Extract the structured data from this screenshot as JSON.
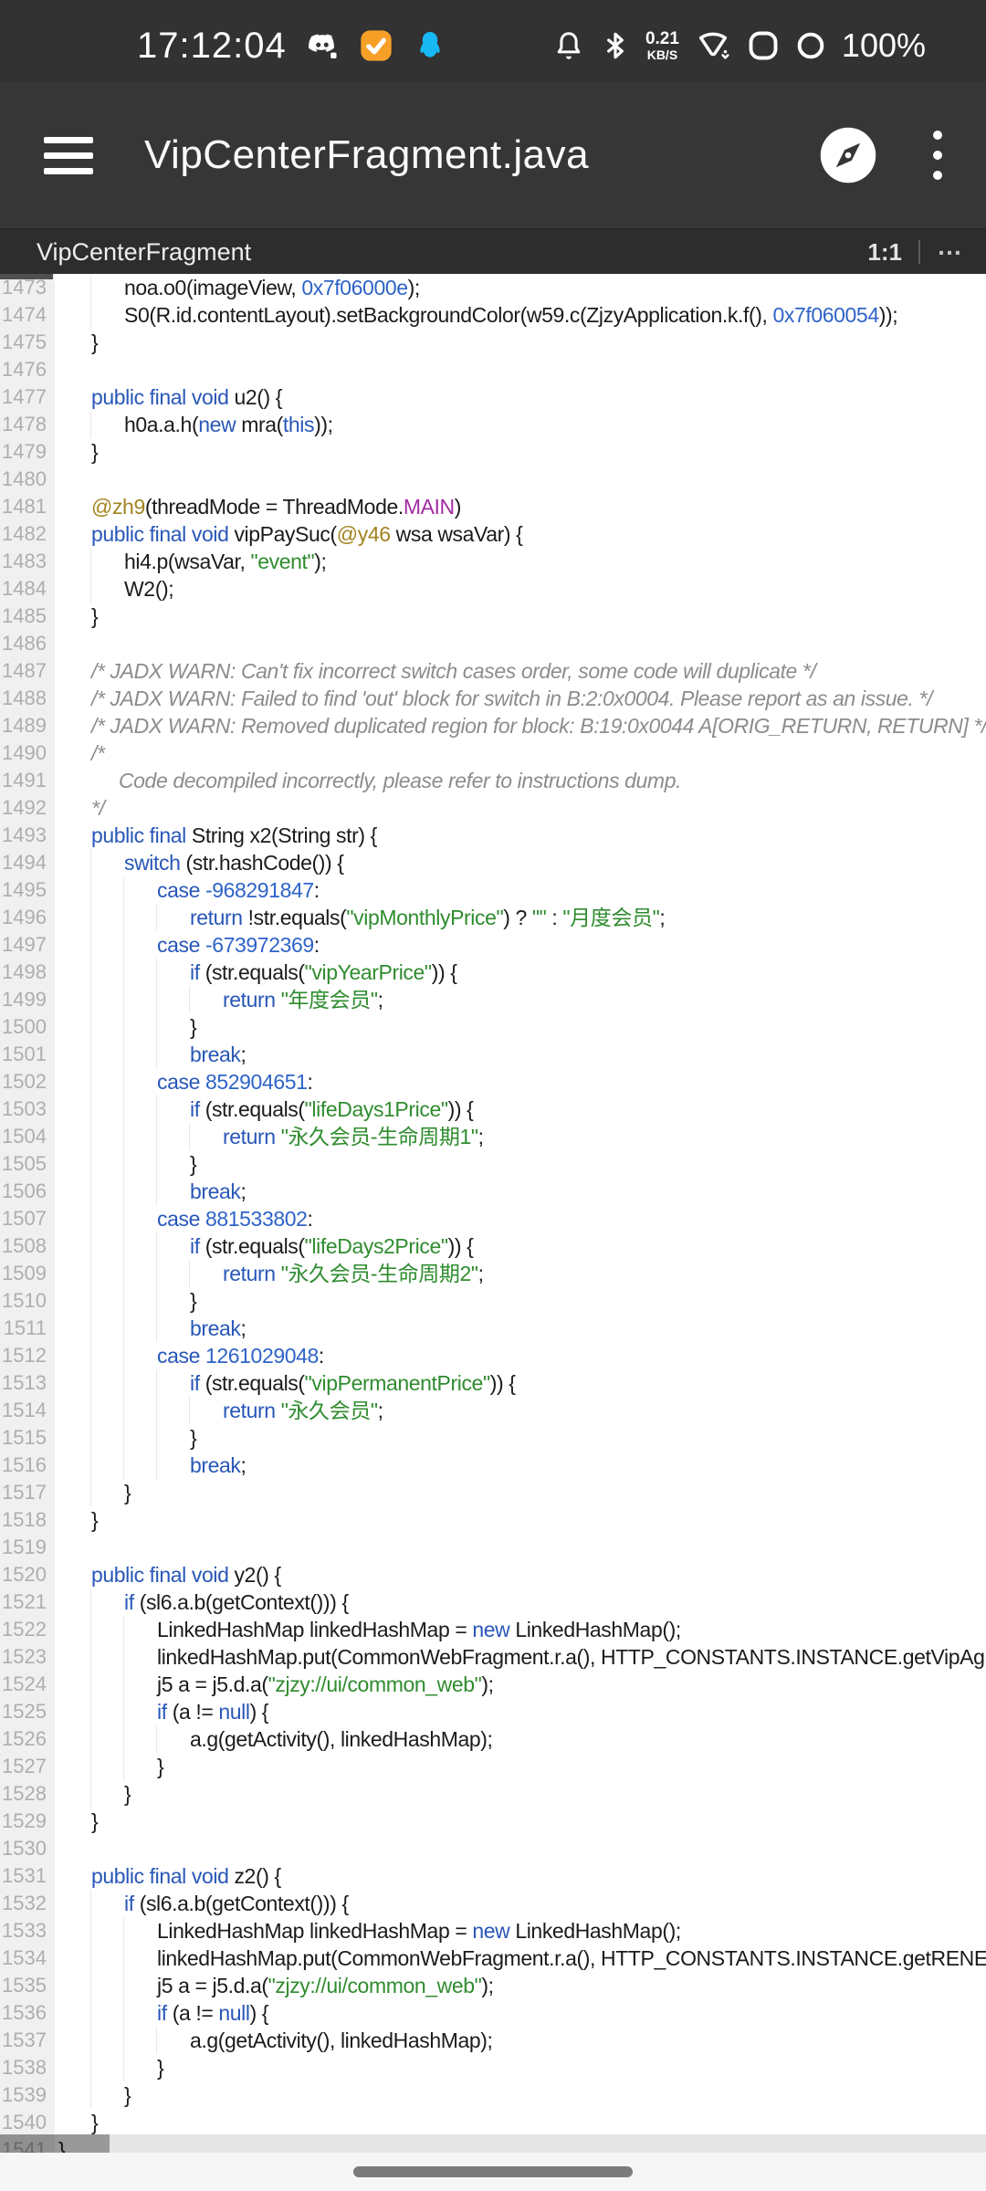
{
  "status_bar": {
    "time": "17:12:04",
    "notification_icons": [
      "discord",
      "checked-task",
      "qq"
    ],
    "system_icons": [
      "notification-bell",
      "bluetooth",
      "wifi",
      "rounded-square-battery",
      "circle-indicator"
    ],
    "network_speed": {
      "value": "0.21",
      "unit": "KB/S"
    },
    "battery_percent": "100%"
  },
  "app_bar": {
    "title": "VipCenterFragment.java"
  },
  "tab_bar": {
    "active_tab": "VipCenterFragment",
    "cursor_position": "1:1",
    "more_label": "…"
  },
  "colors": {
    "header_bg": "#363636",
    "tabbar_bg": "#2d2d2d",
    "code_bg": "#ffffff",
    "gutter_bg": "#f0f0f0",
    "keyword": "#2857b8",
    "number": "#2e63c8",
    "string": "#2f8c2f",
    "annotation": "#a2831d",
    "constant": "#a12ba1",
    "comment": "#8c8c8c",
    "qq_blue": "#18b9f2",
    "badge_orange": "#f7a028"
  },
  "editor": {
    "lines": [
      {
        "n": 1473,
        "i": 2,
        "s": [
          [
            "p",
            "noa.o0(imageView, "
          ],
          [
            "n",
            "0x7f06000e"
          ],
          [
            "p",
            ");"
          ]
        ]
      },
      {
        "n": 1474,
        "i": 2,
        "s": [
          [
            "p",
            "S0(R.id.contentLayout).setBackgroundColor(w59.c(ZjzyApplication.k.f(), "
          ],
          [
            "n",
            "0x7f060054"
          ],
          [
            "p",
            "));"
          ]
        ]
      },
      {
        "n": 1475,
        "i": 1,
        "s": [
          [
            "p",
            "}"
          ]
        ]
      },
      {
        "n": 1476,
        "i": 0,
        "s": []
      },
      {
        "n": 1477,
        "i": 1,
        "s": [
          [
            "k",
            "public final void"
          ],
          [
            "p",
            " u2() {"
          ]
        ]
      },
      {
        "n": 1478,
        "i": 2,
        "s": [
          [
            "p",
            "h0a.a.h("
          ],
          [
            "k",
            "new"
          ],
          [
            "p",
            " mra("
          ],
          [
            "k",
            "this"
          ],
          [
            "p",
            "));"
          ]
        ]
      },
      {
        "n": 1479,
        "i": 1,
        "s": [
          [
            "p",
            "}"
          ]
        ]
      },
      {
        "n": 1480,
        "i": 0,
        "s": []
      },
      {
        "n": 1481,
        "i": 1,
        "s": [
          [
            "a",
            "@zh9"
          ],
          [
            "p",
            "(threadMode = ThreadMode."
          ],
          [
            "e",
            "MAIN"
          ],
          [
            "p",
            ")"
          ]
        ]
      },
      {
        "n": 1482,
        "i": 1,
        "s": [
          [
            "k",
            "public final void"
          ],
          [
            "p",
            " vipPaySuc("
          ],
          [
            "a",
            "@y46"
          ],
          [
            "p",
            " wsa wsaVar) {"
          ]
        ]
      },
      {
        "n": 1483,
        "i": 2,
        "s": [
          [
            "p",
            "hi4.p(wsaVar, "
          ],
          [
            "s",
            "\"event\""
          ],
          [
            "p",
            ");"
          ]
        ]
      },
      {
        "n": 1484,
        "i": 2,
        "s": [
          [
            "p",
            "W2();"
          ]
        ]
      },
      {
        "n": 1485,
        "i": 1,
        "s": [
          [
            "p",
            "}"
          ]
        ]
      },
      {
        "n": 1486,
        "i": 0,
        "s": []
      },
      {
        "n": 1487,
        "i": 1,
        "s": [
          [
            "c",
            "/* JADX WARN: Can't fix incorrect switch cases order, some code will duplicate */"
          ]
        ]
      },
      {
        "n": 1488,
        "i": 1,
        "s": [
          [
            "c",
            "/* JADX WARN: Failed to find 'out' block for switch in B:2:0x0004. Please report as an issue. */"
          ]
        ]
      },
      {
        "n": 1489,
        "i": 1,
        "s": [
          [
            "c",
            "/* JADX WARN: Removed duplicated region for block: B:19:0x0044 A[ORIG_RETURN, RETURN] */"
          ]
        ]
      },
      {
        "n": 1490,
        "i": 1,
        "s": [
          [
            "c",
            "/*"
          ]
        ]
      },
      {
        "n": 1491,
        "i": 1,
        "s": [
          [
            "c",
            "     Code decompiled incorrectly, please refer to instructions dump."
          ]
        ]
      },
      {
        "n": 1492,
        "i": 1,
        "s": [
          [
            "c",
            "*/"
          ]
        ]
      },
      {
        "n": 1493,
        "i": 1,
        "s": [
          [
            "k",
            "public final"
          ],
          [
            "p",
            " String x2(String str) {"
          ]
        ]
      },
      {
        "n": 1494,
        "i": 2,
        "s": [
          [
            "k",
            "switch"
          ],
          [
            "p",
            " (str.hashCode()) {"
          ]
        ]
      },
      {
        "n": 1495,
        "i": 3,
        "s": [
          [
            "k",
            "case"
          ],
          [
            "p",
            " "
          ],
          [
            "n",
            "-968291847"
          ],
          [
            "p",
            ":"
          ]
        ]
      },
      {
        "n": 1496,
        "i": 4,
        "s": [
          [
            "k",
            "return"
          ],
          [
            "p",
            " !str.equals("
          ],
          [
            "s",
            "\"vipMonthlyPrice\""
          ],
          [
            "p",
            ") ? "
          ],
          [
            "s",
            "\"\""
          ],
          [
            "p",
            " : "
          ],
          [
            "s",
            "\"月度会员\""
          ],
          [
            "p",
            ";"
          ]
        ]
      },
      {
        "n": 1497,
        "i": 3,
        "s": [
          [
            "k",
            "case"
          ],
          [
            "p",
            " "
          ],
          [
            "n",
            "-673972369"
          ],
          [
            "p",
            ":"
          ]
        ]
      },
      {
        "n": 1498,
        "i": 4,
        "s": [
          [
            "k",
            "if"
          ],
          [
            "p",
            " (str.equals("
          ],
          [
            "s",
            "\"vipYearPrice\""
          ],
          [
            "p",
            ")) {"
          ]
        ]
      },
      {
        "n": 1499,
        "i": 5,
        "s": [
          [
            "k",
            "return"
          ],
          [
            "p",
            " "
          ],
          [
            "s",
            "\"年度会员\""
          ],
          [
            "p",
            ";"
          ]
        ]
      },
      {
        "n": 1500,
        "i": 4,
        "s": [
          [
            "p",
            "}"
          ]
        ]
      },
      {
        "n": 1501,
        "i": 4,
        "s": [
          [
            "k",
            "break"
          ],
          [
            "p",
            ";"
          ]
        ]
      },
      {
        "n": 1502,
        "i": 3,
        "s": [
          [
            "k",
            "case"
          ],
          [
            "p",
            " "
          ],
          [
            "n",
            "852904651"
          ],
          [
            "p",
            ":"
          ]
        ]
      },
      {
        "n": 1503,
        "i": 4,
        "s": [
          [
            "k",
            "if"
          ],
          [
            "p",
            " (str.equals("
          ],
          [
            "s",
            "\"lifeDays1Price\""
          ],
          [
            "p",
            ")) {"
          ]
        ]
      },
      {
        "n": 1504,
        "i": 5,
        "s": [
          [
            "k",
            "return"
          ],
          [
            "p",
            " "
          ],
          [
            "s",
            "\"永久会员-生命周期1\""
          ],
          [
            "p",
            ";"
          ]
        ]
      },
      {
        "n": 1505,
        "i": 4,
        "s": [
          [
            "p",
            "}"
          ]
        ]
      },
      {
        "n": 1506,
        "i": 4,
        "s": [
          [
            "k",
            "break"
          ],
          [
            "p",
            ";"
          ]
        ]
      },
      {
        "n": 1507,
        "i": 3,
        "s": [
          [
            "k",
            "case"
          ],
          [
            "p",
            " "
          ],
          [
            "n",
            "881533802"
          ],
          [
            "p",
            ":"
          ]
        ]
      },
      {
        "n": 1508,
        "i": 4,
        "s": [
          [
            "k",
            "if"
          ],
          [
            "p",
            " (str.equals("
          ],
          [
            "s",
            "\"lifeDays2Price\""
          ],
          [
            "p",
            ")) {"
          ]
        ]
      },
      {
        "n": 1509,
        "i": 5,
        "s": [
          [
            "k",
            "return"
          ],
          [
            "p",
            " "
          ],
          [
            "s",
            "\"永久会员-生命周期2\""
          ],
          [
            "p",
            ";"
          ]
        ]
      },
      {
        "n": 1510,
        "i": 4,
        "s": [
          [
            "p",
            "}"
          ]
        ]
      },
      {
        "n": 1511,
        "i": 4,
        "s": [
          [
            "k",
            "break"
          ],
          [
            "p",
            ";"
          ]
        ]
      },
      {
        "n": 1512,
        "i": 3,
        "s": [
          [
            "k",
            "case"
          ],
          [
            "p",
            " "
          ],
          [
            "n",
            "1261029048"
          ],
          [
            "p",
            ":"
          ]
        ]
      },
      {
        "n": 1513,
        "i": 4,
        "s": [
          [
            "k",
            "if"
          ],
          [
            "p",
            " (str.equals("
          ],
          [
            "s",
            "\"vipPermanentPrice\""
          ],
          [
            "p",
            ")) {"
          ]
        ]
      },
      {
        "n": 1514,
        "i": 5,
        "s": [
          [
            "k",
            "return"
          ],
          [
            "p",
            " "
          ],
          [
            "s",
            "\"永久会员\""
          ],
          [
            "p",
            ";"
          ]
        ]
      },
      {
        "n": 1515,
        "i": 4,
        "s": [
          [
            "p",
            "}"
          ]
        ]
      },
      {
        "n": 1516,
        "i": 4,
        "s": [
          [
            "k",
            "break"
          ],
          [
            "p",
            ";"
          ]
        ]
      },
      {
        "n": 1517,
        "i": 2,
        "s": [
          [
            "p",
            "}"
          ]
        ]
      },
      {
        "n": 1518,
        "i": 1,
        "s": [
          [
            "p",
            "}"
          ]
        ]
      },
      {
        "n": 1519,
        "i": 0,
        "s": []
      },
      {
        "n": 1520,
        "i": 1,
        "s": [
          [
            "k",
            "public final void"
          ],
          [
            "p",
            " y2() {"
          ]
        ]
      },
      {
        "n": 1521,
        "i": 2,
        "s": [
          [
            "k",
            "if"
          ],
          [
            "p",
            " (sl6.a.b(getContext())) {"
          ]
        ]
      },
      {
        "n": 1522,
        "i": 3,
        "s": [
          [
            "p",
            "LinkedHashMap linkedHashMap = "
          ],
          [
            "k",
            "new"
          ],
          [
            "p",
            " LinkedHashMap();"
          ]
        ]
      },
      {
        "n": 1523,
        "i": 3,
        "s": [
          [
            "p",
            "linkedHashMap.put(CommonWebFragment.r.a(), HTTP_CONSTANTS.INSTANCE.getVipAgreeme"
          ]
        ]
      },
      {
        "n": 1524,
        "i": 3,
        "s": [
          [
            "p",
            "j5 a = j5.d.a("
          ],
          [
            "s",
            "\"zjzy://ui/common_web\""
          ],
          [
            "p",
            ");"
          ]
        ]
      },
      {
        "n": 1525,
        "i": 3,
        "s": [
          [
            "k",
            "if"
          ],
          [
            "p",
            " (a != "
          ],
          [
            "k",
            "null"
          ],
          [
            "p",
            ") {"
          ]
        ]
      },
      {
        "n": 1526,
        "i": 4,
        "s": [
          [
            "p",
            "a.g(getActivity(), linkedHashMap);"
          ]
        ]
      },
      {
        "n": 1527,
        "i": 3,
        "s": [
          [
            "p",
            "}"
          ]
        ]
      },
      {
        "n": 1528,
        "i": 2,
        "s": [
          [
            "p",
            "}"
          ]
        ]
      },
      {
        "n": 1529,
        "i": 1,
        "s": [
          [
            "p",
            "}"
          ]
        ]
      },
      {
        "n": 1530,
        "i": 0,
        "s": []
      },
      {
        "n": 1531,
        "i": 1,
        "s": [
          [
            "k",
            "public final void"
          ],
          [
            "p",
            " z2() {"
          ]
        ]
      },
      {
        "n": 1532,
        "i": 2,
        "s": [
          [
            "k",
            "if"
          ],
          [
            "p",
            " (sl6.a.b(getContext())) {"
          ]
        ]
      },
      {
        "n": 1533,
        "i": 3,
        "s": [
          [
            "p",
            "LinkedHashMap linkedHashMap = "
          ],
          [
            "k",
            "new"
          ],
          [
            "p",
            " LinkedHashMap();"
          ]
        ]
      },
      {
        "n": 1534,
        "i": 3,
        "s": [
          [
            "p",
            "linkedHashMap.put(CommonWebFragment.r.a(), HTTP_CONSTANTS.INSTANCE.getRENEWPRO"
          ]
        ]
      },
      {
        "n": 1535,
        "i": 3,
        "s": [
          [
            "p",
            "j5 a = j5.d.a("
          ],
          [
            "s",
            "\"zjzy://ui/common_web\""
          ],
          [
            "p",
            ");"
          ]
        ]
      },
      {
        "n": 1536,
        "i": 3,
        "s": [
          [
            "k",
            "if"
          ],
          [
            "p",
            " (a != "
          ],
          [
            "k",
            "null"
          ],
          [
            "p",
            ") {"
          ]
        ]
      },
      {
        "n": 1537,
        "i": 4,
        "s": [
          [
            "p",
            "a.g(getActivity(), linkedHashMap);"
          ]
        ]
      },
      {
        "n": 1538,
        "i": 3,
        "s": [
          [
            "p",
            "}"
          ]
        ]
      },
      {
        "n": 1539,
        "i": 2,
        "s": [
          [
            "p",
            "}"
          ]
        ]
      },
      {
        "n": 1540,
        "i": 1,
        "s": [
          [
            "p",
            "}"
          ]
        ]
      },
      {
        "n": 1541,
        "i": 0,
        "s": [
          [
            "p",
            "}"
          ]
        ]
      }
    ]
  }
}
